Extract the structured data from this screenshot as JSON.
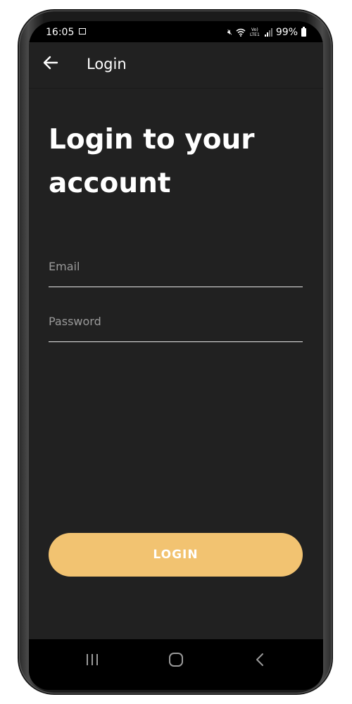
{
  "status": {
    "time": "16:05",
    "battery": "99%",
    "network": "VoLTE1"
  },
  "app_bar": {
    "title": "Login",
    "back_icon": "arrow-left-icon"
  },
  "heading": "Login to your account",
  "form": {
    "email_placeholder": "Email",
    "password_placeholder": "Password"
  },
  "login_button": {
    "label": "LOGIN",
    "color": "#f2c371"
  },
  "nav": {
    "recents_icon": "recents-icon",
    "home_icon": "home-icon",
    "back_icon": "nav-back-icon"
  },
  "colors": {
    "background": "#212121",
    "accent": "#f2c371",
    "text": "#ffffff",
    "placeholder": "#9a9a9a"
  }
}
